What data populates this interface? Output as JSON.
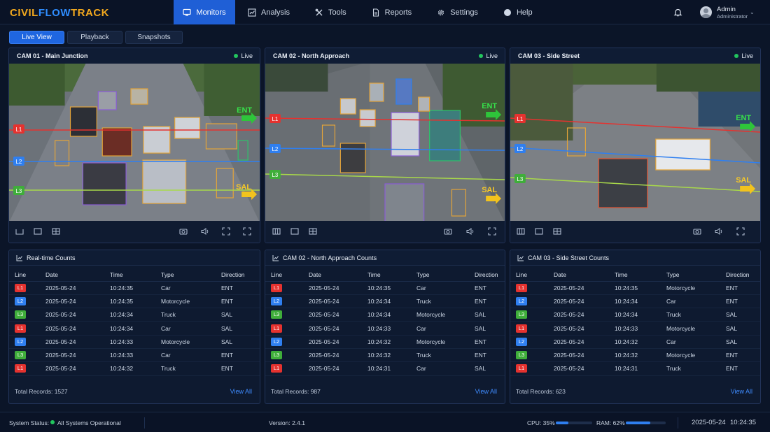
{
  "app": {
    "logo_part1": "CIVIL",
    "logo_part2": "FLOW",
    "logo_part3": "TRACK",
    "brand_orange": "#f2a81e",
    "brand_blue": "#2f8dff"
  },
  "nav": [
    {
      "label": "Monitors",
      "icon": "monitor-icon",
      "active": true
    },
    {
      "label": "Analysis",
      "icon": "chart-icon"
    },
    {
      "label": "Tools",
      "icon": "tools-icon"
    },
    {
      "label": "Reports",
      "icon": "document-icon"
    },
    {
      "label": "Settings",
      "icon": "gear-icon"
    },
    {
      "label": "Help",
      "icon": "help-icon"
    }
  ],
  "user": {
    "name": "Admin",
    "role": "Administrator"
  },
  "subtabs": [
    "Live View",
    "Playback",
    "Snapshots"
  ],
  "cameras": [
    {
      "title": "CAM 01 - Main Junction",
      "status": "Live",
      "lines": [
        "L1",
        "L2",
        "L3"
      ],
      "enter_label": "ENT",
      "exit_label": "SAL"
    },
    {
      "title": "CAM 02 - North Approach",
      "status": "Live",
      "lines": [
        "L1",
        "L2",
        "L3"
      ],
      "enter_label": "ENT",
      "exit_label": "SAL"
    },
    {
      "title": "CAM 03 - Side Street",
      "status": "Live",
      "lines": [
        "L1",
        "L2",
        "L3"
      ],
      "enter_label": "ENT",
      "exit_label": "SAL"
    }
  ],
  "line_colors": {
    "L1": "#e5322f",
    "L2": "#2f7ff0",
    "L3": "#3fae3a"
  },
  "panels": [
    {
      "title": "Real-time Counts",
      "columns": [
        "Line",
        "Date",
        "Time",
        "Type",
        "Direction"
      ],
      "rows": [
        [
          "L1",
          "2025-05-24",
          "10:24:35",
          "Car",
          "ENT"
        ],
        [
          "L2",
          "2025-05-24",
          "10:24:35",
          "Motorcycle",
          "ENT"
        ],
        [
          "L3",
          "2025-05-24",
          "10:24:34",
          "Truck",
          "SAL"
        ],
        [
          "L1",
          "2025-05-24",
          "10:24:34",
          "Car",
          "SAL"
        ],
        [
          "L2",
          "2025-05-24",
          "10:24:33",
          "Motorcycle",
          "SAL"
        ],
        [
          "L3",
          "2025-05-24",
          "10:24:33",
          "Car",
          "ENT"
        ],
        [
          "L1",
          "2025-05-24",
          "10:24:32",
          "Truck",
          "ENT"
        ]
      ],
      "total": "Total Records: 1527",
      "view_all": "View All"
    },
    {
      "title": "CAM 02 - North Approach Counts",
      "columns": [
        "Line",
        "Date",
        "Time",
        "Type",
        "Direction"
      ],
      "rows": [
        [
          "L1",
          "2025-05-24",
          "10:24:35",
          "Car",
          "ENT"
        ],
        [
          "L2",
          "2025-05-24",
          "10:24:34",
          "Truck",
          "ENT"
        ],
        [
          "L3",
          "2025-05-24",
          "10:24:34",
          "Motorcycle",
          "SAL"
        ],
        [
          "L1",
          "2025-05-24",
          "10:24:33",
          "Car",
          "SAL"
        ],
        [
          "L2",
          "2025-05-24",
          "10:24:32",
          "Motorcycle",
          "ENT"
        ],
        [
          "L3",
          "2025-05-24",
          "10:24:32",
          "Truck",
          "ENT"
        ],
        [
          "L1",
          "2025-05-24",
          "10:24:31",
          "Car",
          "SAL"
        ]
      ],
      "total": "Total Records: 987",
      "view_all": "View All"
    },
    {
      "title": "CAM 03 - Side Street Counts",
      "columns": [
        "Line",
        "Date",
        "Time",
        "Type",
        "Direction"
      ],
      "rows": [
        [
          "L1",
          "2025-05-24",
          "10:24:35",
          "Motorcycle",
          "ENT"
        ],
        [
          "L2",
          "2025-05-24",
          "10:24:34",
          "Car",
          "ENT"
        ],
        [
          "L3",
          "2025-05-24",
          "10:24:34",
          "Truck",
          "SAL"
        ],
        [
          "L1",
          "2025-05-24",
          "10:24:33",
          "Motorcycle",
          "SAL"
        ],
        [
          "L2",
          "2025-05-24",
          "10:24:32",
          "Car",
          "SAL"
        ],
        [
          "L3",
          "2025-05-24",
          "10:24:32",
          "Motorcycle",
          "ENT"
        ],
        [
          "L1",
          "2025-05-24",
          "10:24:31",
          "Truck",
          "ENT"
        ]
      ],
      "total": "Total Records: 623",
      "view_all": "View All"
    }
  ],
  "status": {
    "label": "System Status:",
    "value": "All Systems Operational",
    "version": "Version: 2.4.1",
    "cpu_label": "CPU: 35%",
    "cpu": 0.35,
    "ram_label": "RAM: 62%",
    "ram": 0.62,
    "date": "2025-05-24",
    "time": "10:24:35"
  }
}
